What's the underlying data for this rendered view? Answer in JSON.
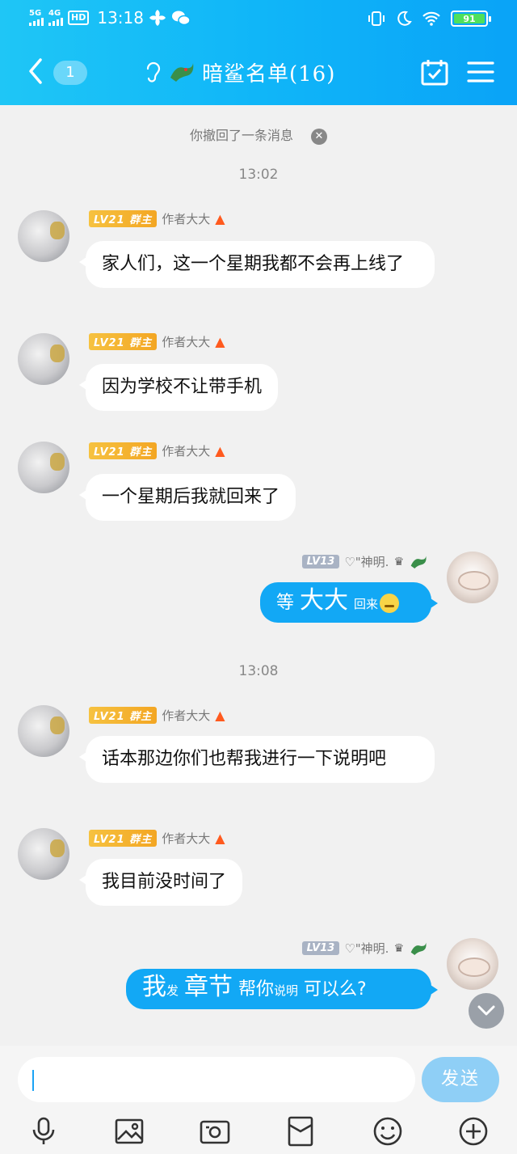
{
  "status_bar": {
    "net1": "5G",
    "net2": "4G",
    "hd": "HD",
    "time": "13:18",
    "battery": "91"
  },
  "nav": {
    "unread_count": "1",
    "title": "暗鲨名单(16)"
  },
  "chat": {
    "recall_notice": "你撤回了一条消息",
    "time1": "13:02",
    "time2": "13:08",
    "messages": [
      {
        "level": "LV21",
        "role": "群主",
        "name": "作者大大",
        "text": "家人们，这一个星期我都不会再上线了"
      },
      {
        "level": "LV21",
        "role": "群主",
        "name": "作者大大",
        "text": "因为学校不让带手机"
      },
      {
        "level": "LV21",
        "role": "群主",
        "name": "作者大大",
        "text": "一个星期后我就回来了"
      },
      {
        "level": "LV13",
        "name": "♡\"神明.",
        "parts": [
          "等",
          "大大",
          "回来"
        ]
      },
      {
        "level": "LV21",
        "role": "群主",
        "name": "作者大大",
        "text": "话本那边你们也帮我进行一下说明吧"
      },
      {
        "level": "LV21",
        "role": "群主",
        "name": "作者大大",
        "text": "我目前没时间了"
      },
      {
        "level": "LV13",
        "name": "♡\"神明.",
        "parts": [
          "我",
          "发",
          "章节",
          "帮你",
          "说明",
          "可以么?"
        ]
      }
    ]
  },
  "input": {
    "send_label": "发送"
  },
  "colors": {
    "header": "#10b6f8",
    "bubble_self": "#12a8f5",
    "level_gold": "#f3a623",
    "level_grey": "#a9b3c4"
  },
  "icons": [
    "back-icon",
    "ear-icon",
    "calendar-check-icon",
    "menu-icon",
    "fire-icon",
    "crown-icon",
    "chevron-down-icon",
    "mic-icon",
    "image-icon",
    "camera-icon",
    "red-packet-icon",
    "emoji-icon",
    "plus-icon"
  ]
}
